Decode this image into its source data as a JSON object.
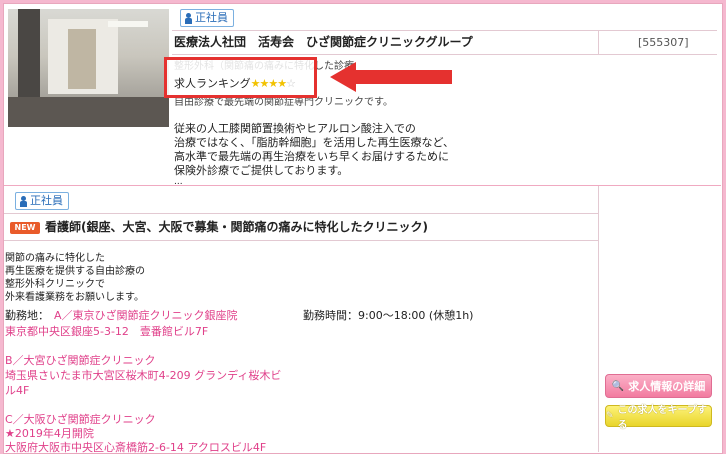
{
  "listing1": {
    "badge": "正社員",
    "company": "医療法人社団　活寿会　ひざ関節症クリニックグループ",
    "id": "[555307]",
    "hidden_line": "整形外科（関節痛の痛みに特化した診療",
    "ranking_label": "求人ランキング",
    "ranking": {
      "filled": 4,
      "total": 5
    },
    "desc_partial": "自由診療で最先端の関節症専門クリニックです。",
    "desc": [
      "従来の人工膝関節置換術やヒアルロン酸注入での",
      "治療ではなく、「脂肪幹細胞」を活用した再生医療など、",
      "高水準で最先端の再生治療をいち早くお届けするために",
      "保険外診療でご提供しております。",
      "..."
    ]
  },
  "listing2": {
    "badge": "正社員",
    "new_label": "NEW",
    "title": "看護師(銀座、大宮、大阪で募集・関節痛の痛みに特化したクリニック)",
    "intro": [
      "関節の痛みに特化した",
      "再生医療を提供する自由診療の",
      "整形外科クリニックで",
      "外来看護業務をお願いします。"
    ],
    "location_label": "勤務地：",
    "location_a_name": "A／東京ひざ関節症クリニック銀座院",
    "location_a_addr": "東京都中央区銀座5-3-12　壹番館ビル7F",
    "hours": "勤務時間：9:00～18:00 (休憩1h)",
    "location_b_name": "B／大宮ひざ関節症クリニック",
    "location_b_addr1": "埼玉県さいたま市大宮区桜木町4-209 グランディ桜木ビ",
    "location_b_addr2": "ル4F",
    "location_c_name": "C／大阪ひざ関節症クリニック",
    "location_c_open": "★2019年4月開院",
    "location_c_addr": "大阪府大阪市中央区心斎橋筋2-6-14 アクロスビル4F"
  },
  "buttons": {
    "detail": "求人情報の詳細",
    "keep": "この求人をキープする"
  },
  "colors": {
    "accent_pink": "#e0408a",
    "highlight_red": "#e5312f",
    "badge_blue": "#2a6db8"
  }
}
